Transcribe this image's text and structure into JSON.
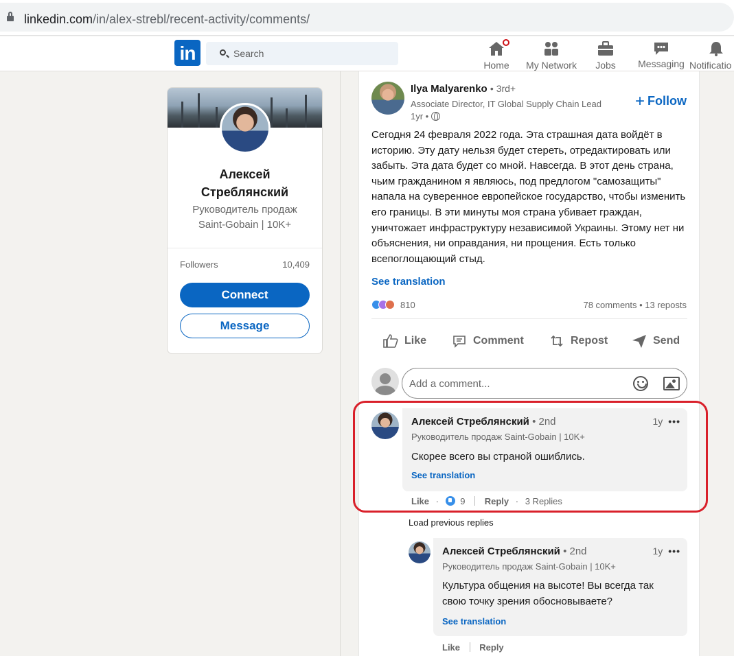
{
  "browser": {
    "url_domain": "linkedin.com",
    "url_path": "/in/alex-strebl/recent-activity/comments/"
  },
  "nav": {
    "logo": "in",
    "search_placeholder": "Search",
    "items": [
      {
        "label": "Home",
        "icon": "home-icon"
      },
      {
        "label": "My Network",
        "icon": "network-icon"
      },
      {
        "label": "Jobs",
        "icon": "briefcase-icon"
      },
      {
        "label": "Messaging",
        "icon": "chat-icon"
      },
      {
        "label": "Notificatio",
        "icon": "bell-icon"
      }
    ]
  },
  "profile": {
    "name_line1": "Алексей",
    "name_line2": "Стреблянский",
    "headline_line1": "Руководитель продаж",
    "headline_line2": "Saint-Gobain | 10K+",
    "followers_label": "Followers",
    "followers_value": "10,409",
    "connect_label": "Connect",
    "message_label": "Message"
  },
  "post": {
    "author_name": "Ilya Malyarenko",
    "author_degree": "• 3rd+",
    "author_headline": "Associate Director, IT Global Supply Chain Lead",
    "time": "1yr •",
    "follow_label": "Follow",
    "text": "Сегодня 24 февраля 2022 года. Эта страшная дата войдёт в историю. Эту дату нельзя будет стереть, отредактировать или забыть. Эта дата будет со мной. Навсегда. В этот день страна, чьим гражданином я являюсь, под предлогом \"самозащиты\" напала на суверенное европейское государство, чтобы изменить его границы. В эти минуты моя страна убивает граждан, уничтожает инфраструктуру независимой Украины. Этому нет ни объяснения, ни оправдания, ни прощения. Есть только всепоглощающий стыд.",
    "see_translation": "See translation",
    "reaction_count": "810",
    "stats": "78 comments • 13 reposts",
    "actions": [
      "Like",
      "Comment",
      "Repost",
      "Send"
    ],
    "comment_placeholder": "Add a comment..."
  },
  "comments": [
    {
      "name": "Алексей Стреблянский",
      "degree": "• 2nd",
      "headline": "Руководитель продаж Saint-Gobain | 10K+",
      "time": "1y",
      "text": "Скорее всего вы страной ошиблись.",
      "see_translation": "See translation",
      "like_label": "Like",
      "like_count": "9",
      "reply_label": "Reply",
      "replies": "3 Replies"
    }
  ],
  "load_previous": "Load previous replies",
  "reply": {
    "name": "Алексей Стреблянский",
    "degree": "• 2nd",
    "headline": "Руководитель продаж Saint-Gobain | 10K+",
    "time": "1y",
    "text_line1": "Культура общения на высоте! Вы всегда так",
    "text_line2": "свою точку зрения обосновываете?",
    "see_translation": "See translation",
    "like_label": "Like",
    "reply_label": "Reply"
  },
  "colors": {
    "brand": "#0a66c2",
    "highlight": "#d9202a",
    "background": "#f3f2ef"
  }
}
